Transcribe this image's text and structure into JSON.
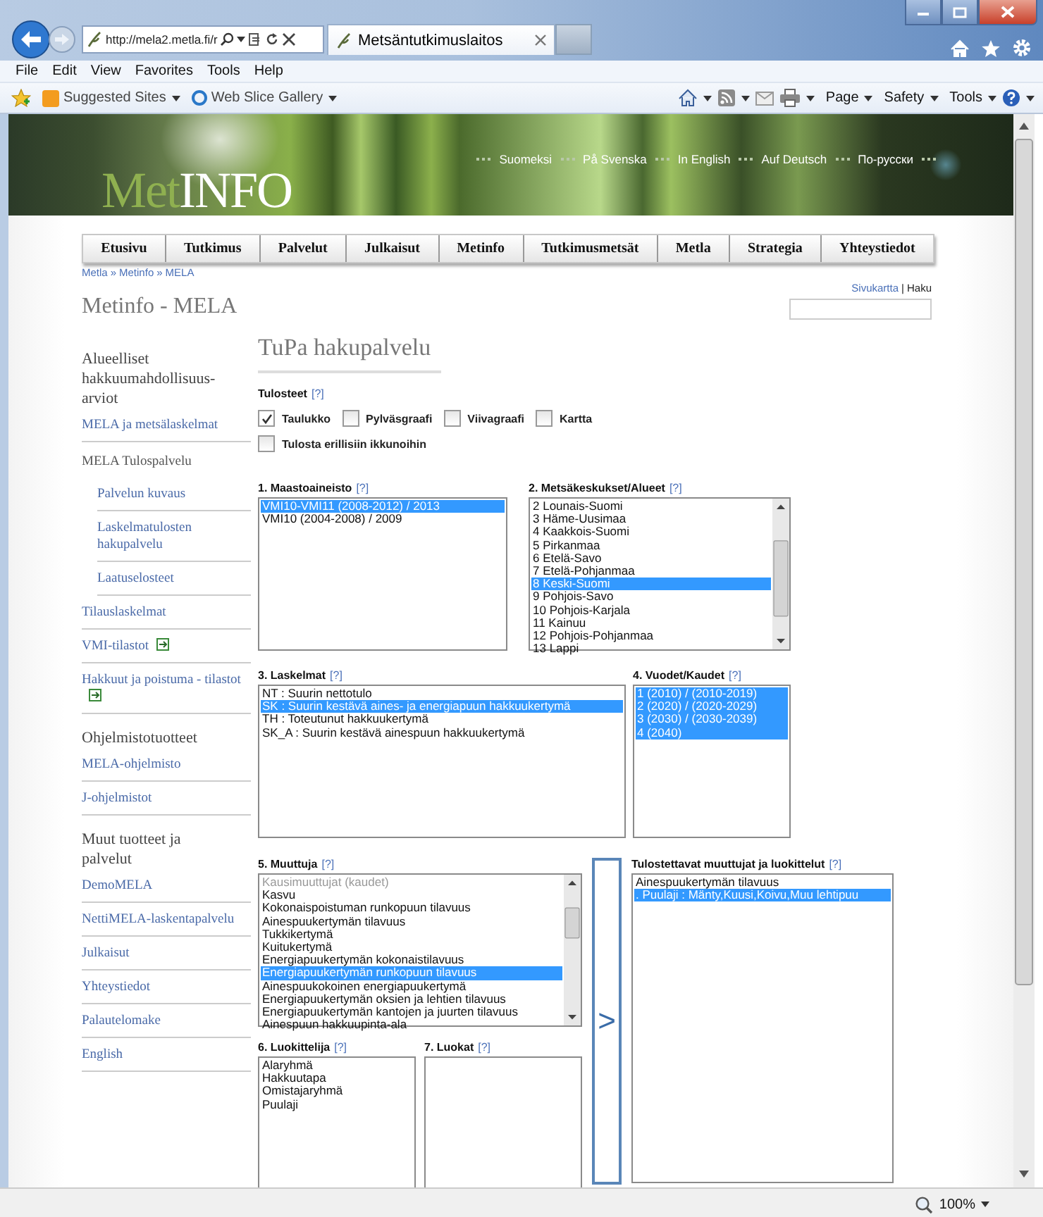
{
  "browser": {
    "address": "http://mela2.metla.fi/r",
    "tab_title": "Metsäntutkimuslaitos",
    "menu": [
      "File",
      "Edit",
      "View",
      "Favorites",
      "Tools",
      "Help"
    ],
    "favorites": [
      "Suggested Sites",
      "Web Slice Gallery"
    ],
    "commands": [
      "Page",
      "Safety",
      "Tools"
    ],
    "zoom": "100%"
  },
  "banner": {
    "logo_part_1": "Met",
    "logo_part_2": "INFO",
    "languages": [
      "Suomeksi",
      "På Svenska",
      "In English",
      "Auf Deutsch",
      "По-русски"
    ]
  },
  "nav": [
    "Etusivu",
    "Tutkimus",
    "Palvelut",
    "Julkaisut",
    "Metinfo",
    "Tutkimusmetsät",
    "Metla",
    "Strategia",
    "Yhteystiedot"
  ],
  "breadcrumb": {
    "separator": "»",
    "items": [
      "Metla",
      "Metinfo",
      "MELA"
    ]
  },
  "page_title": "Metinfo - MELA",
  "top_links": {
    "sitemap": "Sivukartta",
    "divider": "|",
    "search": "Haku"
  },
  "sidebar": [
    {
      "kind": "heading",
      "text": "Alueelliset hakkuumahdollisuus-arviot",
      "expandable": false
    },
    {
      "kind": "link",
      "text": "MELA ja metsälaskelmat",
      "expandable": false
    },
    {
      "kind": "label",
      "text": "MELA Tulospalvelu",
      "expandable": false
    },
    {
      "kind": "sublink",
      "text": "Palvelun kuvaus",
      "expandable": false
    },
    {
      "kind": "sublink",
      "text": "Laskelmatulosten hakupalvelu",
      "expandable": false
    },
    {
      "kind": "sublink",
      "text": "Laatuselosteet",
      "expandable": false
    },
    {
      "kind": "link",
      "text": "Tilauslaskelmat",
      "expandable": false
    },
    {
      "kind": "link",
      "text": "VMI-tilastot",
      "expandable": true
    },
    {
      "kind": "link",
      "text": "Hakkuut ja poistuma - tilastot",
      "expandable": true
    },
    {
      "kind": "heading",
      "text": "Ohjelmistotuotteet",
      "expandable": false
    },
    {
      "kind": "link",
      "text": "MELA-ohjelmisto",
      "expandable": false
    },
    {
      "kind": "link",
      "text": "J-ohjelmistot",
      "expandable": false
    },
    {
      "kind": "heading",
      "text": "Muut tuotteet ja palvelut",
      "expandable": false
    },
    {
      "kind": "link",
      "text": "DemoMELA",
      "expandable": false
    },
    {
      "kind": "link",
      "text": "NettiMELA-laskentapalvelu",
      "expandable": false
    },
    {
      "kind": "link",
      "text": "Julkaisut",
      "expandable": false
    },
    {
      "kind": "link",
      "text": "Yhteystiedot",
      "expandable": false
    },
    {
      "kind": "link",
      "text": "Palautelomake",
      "expandable": false
    },
    {
      "kind": "link",
      "text": "English",
      "expandable": false
    }
  ],
  "main": {
    "title": "TuPa hakupalvelu",
    "outputs": {
      "label": "Tulosteet",
      "help": "[?]",
      "options": [
        {
          "label": "Taulukko",
          "checked": true
        },
        {
          "label": "Pylväsgraafi",
          "checked": false
        },
        {
          "label": "Viivagraafi",
          "checked": false
        },
        {
          "label": "Kartta",
          "checked": false
        }
      ],
      "separate_windows": {
        "label": "Tulosta erillisiin ikkunoihin",
        "checked": false
      }
    },
    "lists": [
      {
        "label": "1. Maastoaineisto",
        "help": "[?]",
        "scrollable": false,
        "items": [
          {
            "text": "VMI10-VMI11 (2008-2012) / 2013",
            "selected": true
          },
          {
            "text": "VMI10 (2004-2008) / 2009",
            "selected": false
          }
        ]
      },
      {
        "label": "2. Metsäkeskukset/Alueet",
        "help": "[?]",
        "scrollable": true,
        "items": [
          {
            "text": "2 Lounais-Suomi",
            "selected": false
          },
          {
            "text": "3 Häme-Uusimaa",
            "selected": false
          },
          {
            "text": "4 Kaakkois-Suomi",
            "selected": false
          },
          {
            "text": "5 Pirkanmaa",
            "selected": false
          },
          {
            "text": "6 Etelä-Savo",
            "selected": false
          },
          {
            "text": "7 Etelä-Pohjanmaa",
            "selected": false
          },
          {
            "text": "8 Keski-Suomi",
            "selected": true
          },
          {
            "text": "9 Pohjois-Savo",
            "selected": false
          },
          {
            "text": "10 Pohjois-Karjala",
            "selected": false
          },
          {
            "text": "11 Kainuu",
            "selected": false
          },
          {
            "text": "12 Pohjois-Pohjanmaa",
            "selected": false
          },
          {
            "text": "13 Lappi",
            "selected": false
          }
        ]
      },
      {
        "label": "3. Laskelmat",
        "help": "[?]",
        "scrollable": false,
        "items": [
          {
            "text": "NT : Suurin nettotulo",
            "selected": false
          },
          {
            "text": "SK : Suurin kestävä aines- ja energiapuun hakkuukertymä",
            "selected": true
          },
          {
            "text": "TH : Toteutunut hakkuukertymä",
            "selected": false
          },
          {
            "text": "SK_A : Suurin kestävä ainespuun hakkuukertymä",
            "selected": false
          }
        ]
      },
      {
        "label": "4. Vuodet/Kaudet",
        "help": "[?]",
        "scrollable": false,
        "items": [
          {
            "text": "1 (2010) / (2010-2019)",
            "selected": true
          },
          {
            "text": "2 (2020) / (2020-2029)",
            "selected": true
          },
          {
            "text": "3 (2030) / (2030-2039)",
            "selected": true
          },
          {
            "text": "4 (2040)",
            "selected": true
          }
        ]
      },
      {
        "label": "5. Muuttuja",
        "help": "[?]",
        "scrollable": true,
        "items": [
          {
            "text": "Kausimuuttujat (kaudet)",
            "selected": false,
            "disabled": true
          },
          {
            "text": "Kasvu",
            "selected": false,
            "disabled": false
          },
          {
            "text": "Kokonaispoistuman runkopuun tilavuus",
            "selected": false,
            "disabled": false
          },
          {
            "text": "Ainespuukertymän tilavuus",
            "selected": false,
            "disabled": false
          },
          {
            "text": "Tukkikertymä",
            "selected": false,
            "disabled": false
          },
          {
            "text": "Kuitukertymä",
            "selected": false,
            "disabled": false
          },
          {
            "text": "Energiapuukertymän kokonaistilavuus",
            "selected": false,
            "disabled": false
          },
          {
            "text": "Energiapuukertymän runkopuun tilavuus",
            "selected": true,
            "disabled": false
          },
          {
            "text": "Ainespuukokoinen energiapuukertymä",
            "selected": false,
            "disabled": false
          },
          {
            "text": "Energiapuukertymän oksien ja lehtien tilavuus",
            "selected": false,
            "disabled": false
          },
          {
            "text": "Energiapuukertymän kantojen ja juurten tilavuus",
            "selected": false,
            "disabled": false
          },
          {
            "text": "Ainespuun hakkuupinta-ala",
            "selected": false,
            "disabled": false
          }
        ]
      },
      {
        "label": "6. Luokittelija",
        "help": "[?]",
        "scrollable": false,
        "items": [
          {
            "text": "Alaryhmä",
            "selected": false
          },
          {
            "text": "Hakkuutapa",
            "selected": false
          },
          {
            "text": "Omistajaryhmä",
            "selected": false
          },
          {
            "text": "Puulaji",
            "selected": false
          }
        ]
      },
      {
        "label": "7. Luokat",
        "help": "[?]",
        "scrollable": false
      },
      {
        "label": "Tulostettavat muuttujat ja luokittelut",
        "help": "[?]",
        "scrollable": false,
        "items": [
          {
            "text": "Ainespuukertymän tilavuus",
            "selected": false
          },
          {
            "text": ". Puulaji : Mänty,Kuusi,Koivu,Muu lehtipuu",
            "selected": true
          }
        ]
      }
    ],
    "add_button": ">"
  }
}
